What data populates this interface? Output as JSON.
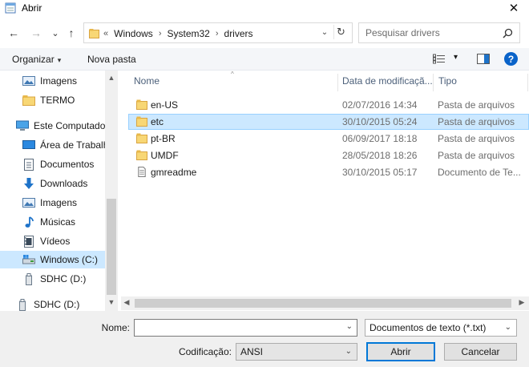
{
  "window": {
    "title": "Abrir",
    "close_glyph": "✕"
  },
  "nav": {
    "back_glyph": "←",
    "forward_glyph": "→",
    "recent_glyph": "⌄",
    "up_glyph": "↑",
    "breadcrumb_lead": "«",
    "breadcrumb": [
      "Windows",
      "System32",
      "drivers"
    ],
    "breadcrumb_sep": "›",
    "dropdown_glyph": "⌄",
    "refresh_glyph": "↻"
  },
  "search": {
    "placeholder": "Pesquisar drivers"
  },
  "toolbar": {
    "organize_label": "Organizar",
    "organize_caret": "▾",
    "new_folder_label": "Nova pasta",
    "view_caret": "▾",
    "help_glyph": "?"
  },
  "sidebar": {
    "items": [
      {
        "label": "Imagens",
        "icon": "pictures-icon",
        "indent": true
      },
      {
        "label": "TERMO",
        "icon": "folder-icon",
        "indent": true
      },
      {
        "label": "Este Computador",
        "icon": "computer-icon",
        "indent": false
      },
      {
        "label": "Área de Trabalh",
        "icon": "desktop-icon",
        "indent": true
      },
      {
        "label": "Documentos",
        "icon": "documents-icon",
        "indent": true
      },
      {
        "label": "Downloads",
        "icon": "downloads-icon",
        "indent": true
      },
      {
        "label": "Imagens",
        "icon": "pictures-icon",
        "indent": true
      },
      {
        "label": "Músicas",
        "icon": "music-icon",
        "indent": true
      },
      {
        "label": "Vídeos",
        "icon": "videos-icon",
        "indent": true
      },
      {
        "label": "Windows (C:)",
        "icon": "drive-icon",
        "indent": true,
        "selected": true
      },
      {
        "label": "SDHC (D:)",
        "icon": "usb-drive-icon",
        "indent": true
      },
      {
        "label": "SDHC (D:)",
        "icon": "usb-drive-icon",
        "indent": false
      }
    ],
    "scroll_up_glyph": "▲",
    "scroll_down_glyph": "▼"
  },
  "columns": {
    "name": "Nome",
    "date": "Data de modificaçã...",
    "type": "Tipo",
    "sort_glyph": "^"
  },
  "files": [
    {
      "name": "en-US",
      "date": "02/07/2016 14:34",
      "type": "Pasta de arquivos",
      "icon": "folder-icon"
    },
    {
      "name": "etc",
      "date": "30/10/2015 05:24",
      "type": "Pasta de arquivos",
      "icon": "folder-icon",
      "selected": true
    },
    {
      "name": "pt-BR",
      "date": "06/09/2017 18:18",
      "type": "Pasta de arquivos",
      "icon": "folder-icon"
    },
    {
      "name": "UMDF",
      "date": "28/05/2018 18:26",
      "type": "Pasta de arquivos",
      "icon": "folder-icon"
    },
    {
      "name": "gmreadme",
      "date": "30/10/2015 05:17",
      "type": "Documento de Te...",
      "icon": "text-file-icon"
    }
  ],
  "hscroll": {
    "left_glyph": "◀",
    "right_glyph": "▶"
  },
  "footer": {
    "name_label": "Nome:",
    "name_value": "",
    "filetype_value": "Documentos de texto (*.txt)",
    "encoding_label": "Codificação:",
    "encoding_value": "ANSI",
    "open_label": "Abrir",
    "cancel_label": "Cancelar",
    "combo_caret": "⌄"
  },
  "colors": {
    "accent": "#0078d7",
    "selection": "#cce8ff",
    "folder": "#f8d775"
  }
}
